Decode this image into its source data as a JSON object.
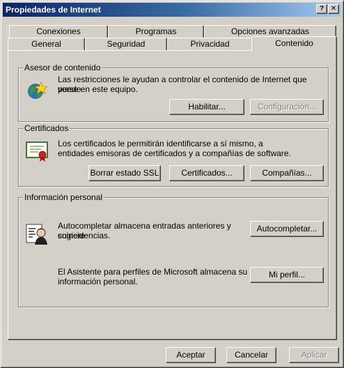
{
  "window": {
    "title": "Propiedades de Internet",
    "help_glyph": "?",
    "close_glyph": "✕"
  },
  "tabs": {
    "back_row": [
      "Conexiones",
      "Programas",
      "Opciones avanzadas"
    ],
    "front_row": [
      "General",
      "Seguridad",
      "Privacidad",
      "Contenido"
    ],
    "active": "Contenido"
  },
  "content_advisor": {
    "title": "Asesor de contenido",
    "description_line1": "Las restricciones le ayudan a controlar el contenido de Internet que puede",
    "description_line2": "verse en este equipo.",
    "enable_label": "Habilitar...",
    "settings_label": "Configuración...",
    "icon": "globe-star-icon"
  },
  "certificates": {
    "title": "Certificados",
    "description_line1": "Los certificados le permitirán identificarse a sí mismo, a",
    "description_line2": "entidades emisoras de certificados y a compañías de software.",
    "clear_ssl_label": "Borrar estado SSL",
    "certificates_label": "Certificados...",
    "publishers_label": "Compañías...",
    "icon": "certificate-icon"
  },
  "personal_info": {
    "title": "Información personal",
    "autocomplete_line1": "Autocompletar almacena entradas anteriores y sugiere",
    "autocomplete_line2": "coincidencias.",
    "autocomplete_label": "Autocompletar...",
    "profile_line1": "El Asistente para perfiles de Microsoft almacena su",
    "profile_line2": "información personal.",
    "profile_label": "Mi perfil...",
    "icon": "profile-card-icon"
  },
  "footer": {
    "ok_label": "Aceptar",
    "cancel_label": "Cancelar",
    "apply_label": "Aplicar"
  }
}
